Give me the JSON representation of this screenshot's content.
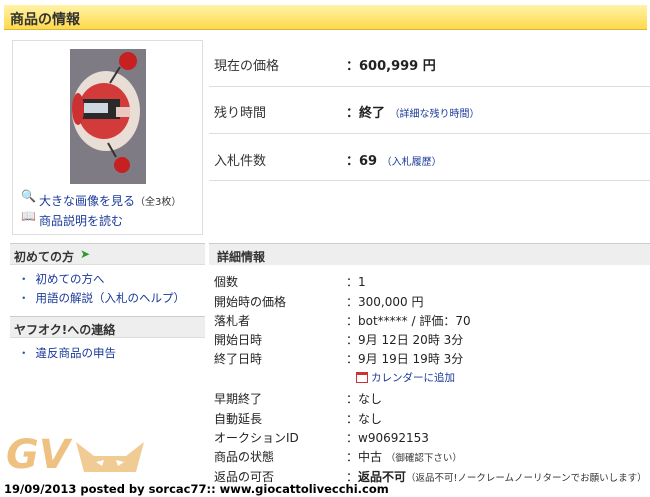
{
  "header": {
    "title": "商品の情報"
  },
  "image_panel": {
    "view_large": "大きな画像を見る",
    "count": "（全3枚）",
    "read_description": "商品説明を読む"
  },
  "summary": [
    {
      "label": "現在の価格",
      "value": "600,999 円",
      "note": ""
    },
    {
      "label": "残り時間",
      "value": "終了",
      "note": "（詳細な残り時間）"
    },
    {
      "label": "入札件数",
      "value": "69",
      "note": "（入札履歴）"
    }
  ],
  "sidebar": {
    "beginner": {
      "title": "初めての方",
      "items": [
        "初めての方へ",
        "用語の解説（入札のヘルプ）"
      ]
    },
    "contact": {
      "title": "ヤフオク!への連絡",
      "items": [
        "違反商品の申告"
      ]
    }
  },
  "details": {
    "title": "詳細情報",
    "rows": [
      {
        "label": "個数",
        "value": "1"
      },
      {
        "label": "開始時の価格",
        "value": "300,000 円"
      },
      {
        "label": "落札者",
        "value": "bot***** / 評価：70"
      },
      {
        "label": "開始日時",
        "value": "9月 12日 20時 3分"
      },
      {
        "label": "終了日時",
        "value": "9月 19日 19時 3分"
      },
      {
        "label": "早期終了",
        "value": "なし"
      },
      {
        "label": "自動延長",
        "value": "なし"
      },
      {
        "label": "オークションID",
        "value": "w90692153"
      },
      {
        "label": "商品の状態",
        "value": "中古",
        "note": "（御確認下さい）"
      },
      {
        "label": "返品の可否",
        "value": "返品不可",
        "note": "（返品不可!ノークレームノーリターンでお願いします）"
      }
    ],
    "calendar": "カレンダーに追加",
    "colon": "："
  },
  "watermark": {
    "logo": "GV"
  },
  "footer": {
    "text": "19/09/2013 posted by sorcac77:: www.giocattolivecchi.com"
  },
  "colors": {
    "header_bg": "#ffd94a",
    "link": "#1a3a99",
    "section_bg": "#eeeeee"
  }
}
